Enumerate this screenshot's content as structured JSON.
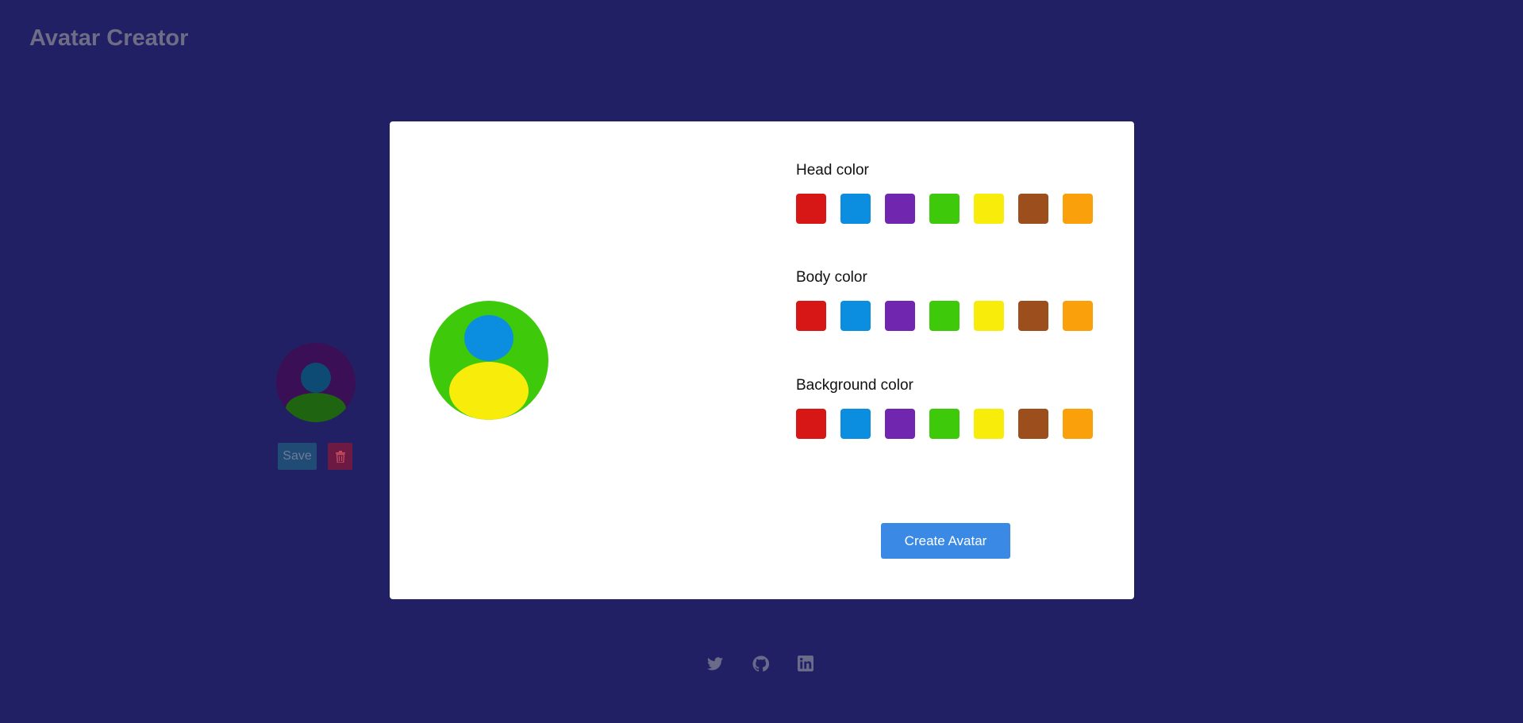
{
  "app": {
    "title": "Avatar Creator"
  },
  "saved_avatar": {
    "colors": {
      "background": "#3a0f55",
      "head": "#0d4b74",
      "body": "#1f6410"
    },
    "save_label": "Save",
    "delete_icon": "trash-icon"
  },
  "editor": {
    "preview_colors": {
      "background": "#3ec90b",
      "head": "#0b8ee0",
      "body": "#f7ec0a"
    },
    "sections": [
      {
        "label": "Head color"
      },
      {
        "label": "Body color"
      },
      {
        "label": "Background color"
      }
    ],
    "swatches": [
      {
        "name": "red",
        "color": "#d71616"
      },
      {
        "name": "blue",
        "color": "#0b8ee0"
      },
      {
        "name": "purple",
        "color": "#7126b0"
      },
      {
        "name": "green",
        "color": "#3ec90b"
      },
      {
        "name": "yellow",
        "color": "#f7ec0a"
      },
      {
        "name": "brown",
        "color": "#9c4f1d"
      },
      {
        "name": "orange",
        "color": "#f9a00a"
      }
    ],
    "create_label": "Create Avatar"
  },
  "footer": {
    "icons": [
      "twitter-icon",
      "github-icon",
      "linkedin-icon"
    ],
    "icon_color": "#6a6b8a"
  }
}
